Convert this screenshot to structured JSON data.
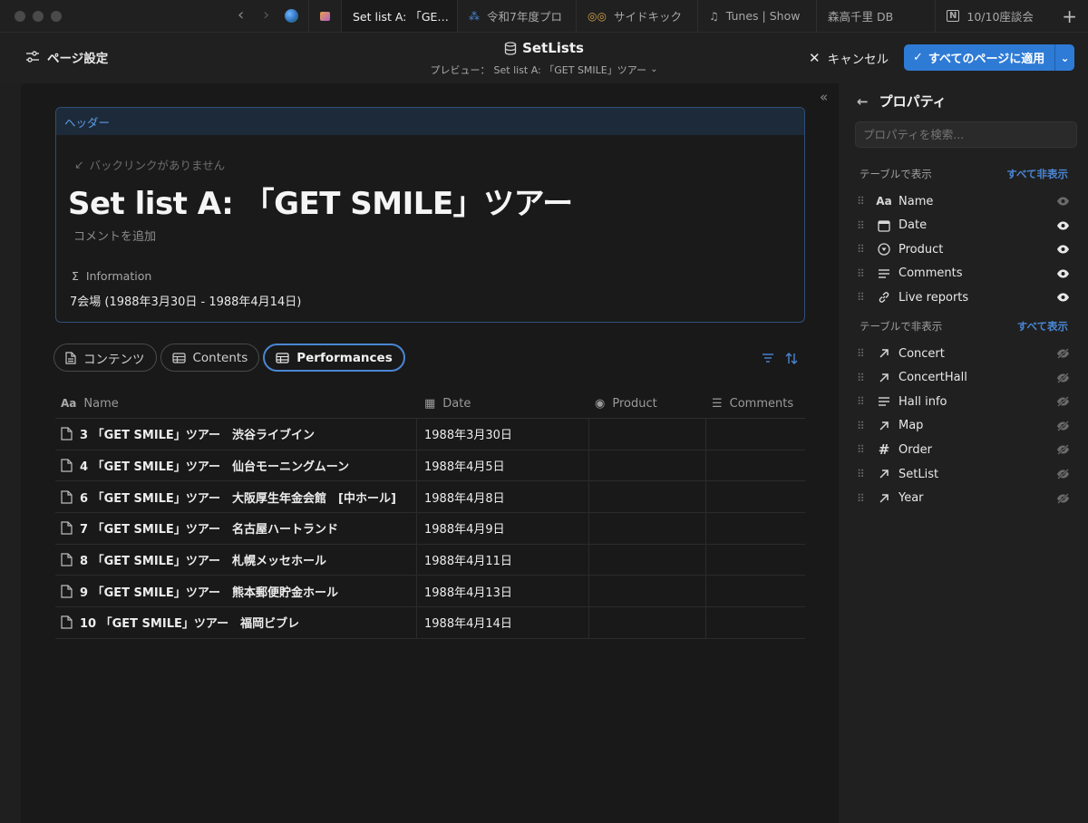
{
  "tabs": [
    {
      "label": "Set list A: 「GE…",
      "icon": "notion-icon",
      "active": true
    },
    {
      "label": "令和7年度プロ",
      "icon": "people-icon"
    },
    {
      "label": "サイドキック",
      "icon": "glasses-icon"
    },
    {
      "label": "Tunes | Show",
      "icon": "music-icon"
    },
    {
      "label": "森高千里 DB",
      "icon": ""
    },
    {
      "label": "10/10座談会",
      "icon": "notion-icon"
    }
  ],
  "topbar": {
    "page_settings": "ページ設定",
    "db_title": "SetLists",
    "preview_label": "プレビュー：",
    "preview_page": "Set list A: 「GET SMILE」ツアー",
    "cancel": "キャンセル",
    "apply": "すべてのページに適用"
  },
  "page": {
    "header_label": "ヘッダー",
    "backlink": "バックリンクがありません",
    "title": "Set list A: 「GET SMILE」ツアー",
    "comment": "コメントを追加",
    "info_label": "Information",
    "info_value": "7会場 (1988年3月30日 - 1988年4月14日)"
  },
  "view_tabs": [
    {
      "label": "コンテンツ",
      "icon": "page-icon"
    },
    {
      "label": "Contents",
      "icon": "table-icon"
    },
    {
      "label": "Performances",
      "icon": "table-icon",
      "active": true
    }
  ],
  "table": {
    "columns": [
      "Name",
      "Date",
      "Product",
      "Comments"
    ],
    "rows": [
      {
        "name": "3 「GET SMILE」ツアー　渋谷ライブイン",
        "date": "1988年3月30日"
      },
      {
        "name": "4 「GET SMILE」ツアー　仙台モーニングムーン",
        "date": "1988年4月5日"
      },
      {
        "name": "6 「GET SMILE」ツアー　大阪厚生年金会館　[中ホール]",
        "date": "1988年4月8日"
      },
      {
        "name": "7 「GET SMILE」ツアー　名古屋ハートランド",
        "date": "1988年4月9日"
      },
      {
        "name": "8 「GET SMILE」ツアー　札幌メッセホール",
        "date": "1988年4月11日"
      },
      {
        "name": "9 「GET SMILE」ツアー　熊本郵便貯金ホール",
        "date": "1988年4月13日"
      },
      {
        "name": "10 「GET SMILE」ツアー　福岡ビブレ",
        "date": "1988年4月14日"
      }
    ]
  },
  "props": {
    "title": "プロパティ",
    "search_placeholder": "プロパティを検索...",
    "shown_label": "テーブルで表示",
    "hide_all": "すべて非表示",
    "hidden_label": "テーブルで非表示",
    "show_all": "すべて表示",
    "shown": [
      {
        "label": "Name",
        "icon": "Aa"
      },
      {
        "label": "Date",
        "icon": "calendar"
      },
      {
        "label": "Product",
        "icon": "select"
      },
      {
        "label": "Comments",
        "icon": "lines"
      },
      {
        "label": "Live reports",
        "icon": "link"
      }
    ],
    "hidden": [
      {
        "label": "Concert",
        "icon": "relation"
      },
      {
        "label": "ConcertHall",
        "icon": "relation"
      },
      {
        "label": "Hall info",
        "icon": "lines"
      },
      {
        "label": "Map",
        "icon": "relation"
      },
      {
        "label": "Order",
        "icon": "#"
      },
      {
        "label": "SetList",
        "icon": "relation"
      },
      {
        "label": "Year",
        "icon": "relation"
      }
    ]
  },
  "colors": {
    "accent": "#2e7bd6",
    "header_border": "#2f4f77",
    "link": "#4a86d4"
  }
}
